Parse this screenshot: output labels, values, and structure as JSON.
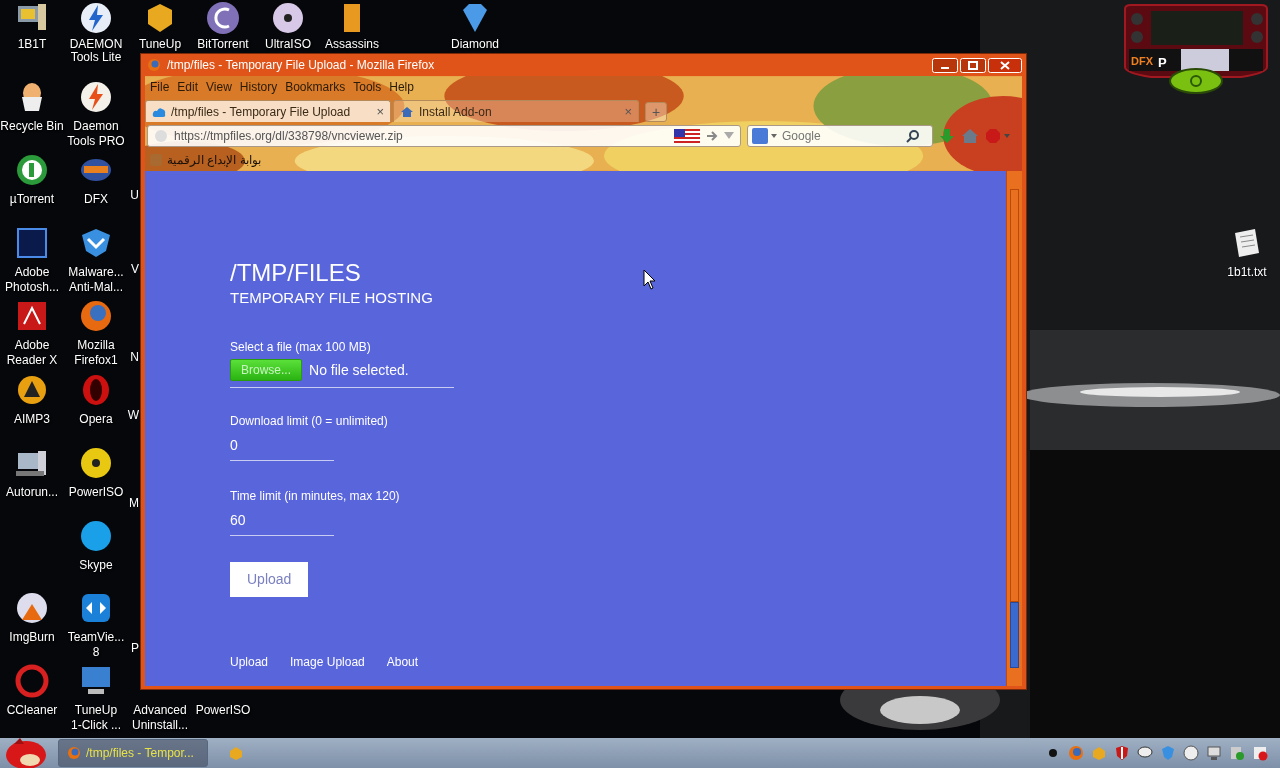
{
  "desktop": {
    "icons": [
      {
        "label": "1B1T"
      },
      {
        "label": "DAEMON\nTools Lite"
      },
      {
        "label": "TuneUp"
      },
      {
        "label": "BitTorrent"
      },
      {
        "label": "UltraISO"
      },
      {
        "label": "Assassins"
      },
      {
        "label": "Diamond"
      },
      {
        "label": "Recycle Bin"
      },
      {
        "label": "Daemon\nTools PRO"
      },
      {
        "label": "µTorrent"
      },
      {
        "label": "DFX"
      },
      {
        "label": "Adobe\nPhotosh..."
      },
      {
        "label": "Malware...\nAnti-Mal..."
      },
      {
        "label": "Adobe\nReader X"
      },
      {
        "label": "Mozilla\nFirefox1"
      },
      {
        "label": "AIMP3"
      },
      {
        "label": "Opera"
      },
      {
        "label": "Autorun..."
      },
      {
        "label": "PowerISO"
      },
      {
        "label": "Skype"
      },
      {
        "label": "ImgBurn"
      },
      {
        "label": "TeamVie...\n8"
      },
      {
        "label": "CCleaner"
      },
      {
        "label": "TuneUp\n1-Click ..."
      },
      {
        "label": "Advanced\nUninstall..."
      },
      {
        "label": "PowerISO"
      },
      {
        "label": "1b1t.txt"
      }
    ],
    "cut_labels": [
      "U",
      "V",
      "N",
      "W",
      "M",
      "P"
    ],
    "audio_widget": {
      "brand": "DFX",
      "preset": "P"
    }
  },
  "window": {
    "title": "/tmp/files - Temporary File Upload - Mozilla Firefox",
    "menu": [
      "File",
      "Edit",
      "View",
      "History",
      "Bookmarks",
      "Tools",
      "Help"
    ],
    "tabs": [
      {
        "label": "/tmp/files - Temporary File Upload",
        "selected": true,
        "close": "×"
      },
      {
        "label": "Install Add-on",
        "selected": false,
        "close": "×"
      }
    ],
    "new_tab": "+",
    "url": "https://tmpfiles.org/dl/338798/vncviewer.zip",
    "search": {
      "placeholder": "Google"
    },
    "bookmark": "بوابة الإبداع الرقمية",
    "page": {
      "title": "/TMP/FILES",
      "subtitle": "TEMPORARY FILE HOSTING",
      "file_label": "Select a file (max 100 MB)",
      "browse": "Browse...",
      "file_status": "No file selected.",
      "fields": [
        {
          "label": "Download limit (0 = unlimited)",
          "value": "0"
        },
        {
          "label": "Time limit (in minutes, max 120)",
          "value": "60"
        }
      ],
      "upload": "Upload",
      "footer_links": [
        "Upload",
        "Image Upload",
        "About"
      ]
    }
  },
  "taskbar": {
    "task": "/tmp/files - Tempor..."
  }
}
